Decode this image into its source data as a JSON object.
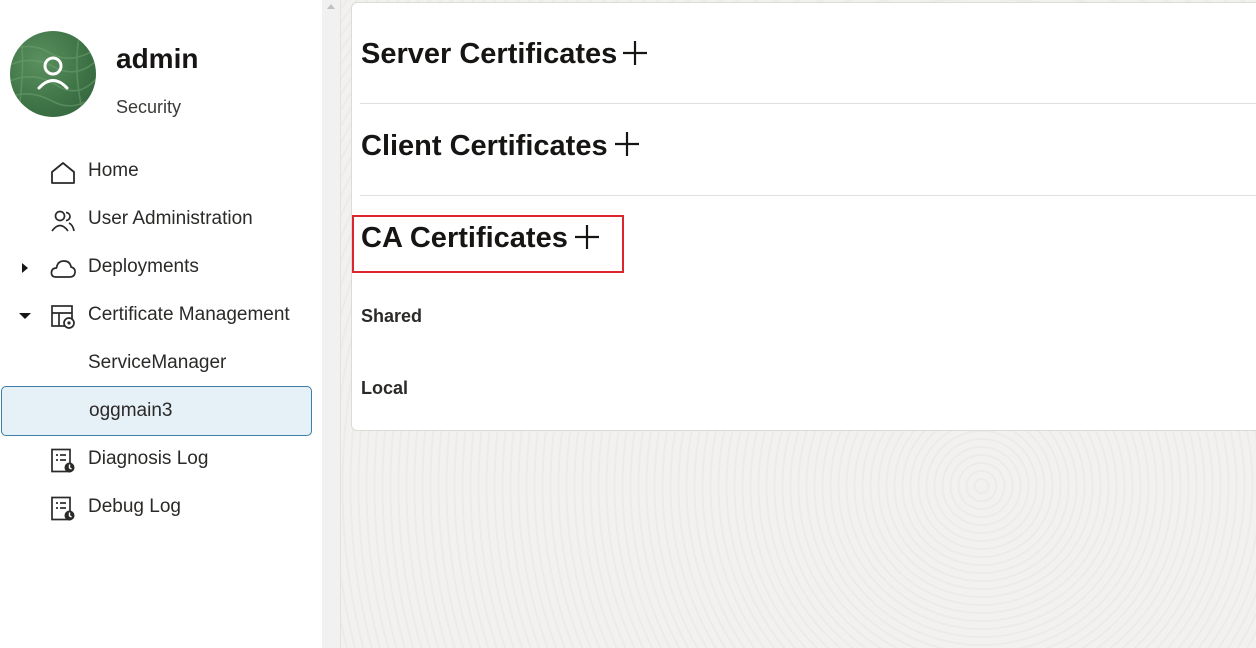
{
  "user": {
    "name": "admin",
    "role": "Security",
    "avatar_icon": "user-icon"
  },
  "nav": {
    "items": [
      {
        "label": "Home",
        "icon": "home-icon"
      },
      {
        "label": "User Administration",
        "icon": "users-icon"
      },
      {
        "label": "Deployments",
        "icon": "cloud-icon",
        "expanded": false
      },
      {
        "label": "Certificate Management",
        "icon": "certificate-icon",
        "expanded": true
      },
      {
        "label": "ServiceManager"
      },
      {
        "label": "oggmain3",
        "selected": true
      },
      {
        "label": "Diagnosis Log",
        "icon": "log-icon"
      },
      {
        "label": "Debug Log",
        "icon": "log-icon"
      }
    ]
  },
  "main": {
    "sections": [
      {
        "title": "Server Certificates",
        "action_icon": "plus-icon"
      },
      {
        "title": "Client Certificates",
        "action_icon": "plus-icon"
      },
      {
        "title": "CA Certificates",
        "action_icon": "plus-icon",
        "highlighted": true
      }
    ],
    "ca_groups": [
      "Shared",
      "Local"
    ]
  },
  "colors": {
    "selected_bg": "#e5f0f7",
    "selected_border": "#3d7ea6",
    "highlight_border": "#d9262f",
    "avatar_green": "#3f7447"
  }
}
